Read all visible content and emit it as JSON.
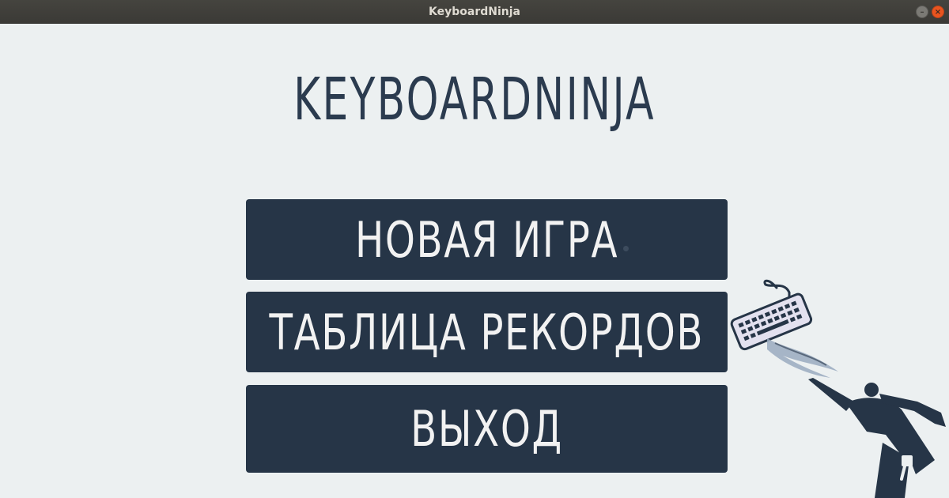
{
  "window": {
    "title": "KeyboardNinja",
    "minimize_glyph": "–",
    "close_glyph": "×"
  },
  "app": {
    "title": "KEYBOARDNINJA"
  },
  "menu": {
    "new_game": "НОВАЯ ИГРА",
    "leaderboard": "ТАБЛИЦА РЕКОРДОВ",
    "exit": "ВЫХОД"
  },
  "icons": {
    "mascot": "ninja-kicking-keyboard-icon"
  },
  "colors": {
    "background": "#ecf0f1",
    "button": "#263547",
    "button_text": "#f2f2f2",
    "title_text": "#2b3b4f",
    "titlebar": "#3b3a36",
    "close_button": "#e9541f"
  }
}
